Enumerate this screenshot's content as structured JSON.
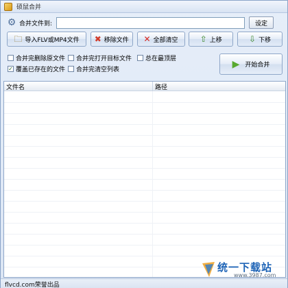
{
  "window": {
    "title": "硕鼠合并"
  },
  "merge_target": {
    "label": "合并文件到:",
    "value": "",
    "placeholder": ""
  },
  "buttons": {
    "set": "设定",
    "import": "导入FLV或MP4文件",
    "remove": "移除文件",
    "clear_all": "全部清空",
    "move_up": "上移",
    "move_down": "下移",
    "start_merge": "开始合并"
  },
  "options": [
    {
      "label": "合并完删除原文件",
      "checked": false
    },
    {
      "label": "合并完打开目标文件",
      "checked": false
    },
    {
      "label": "总在最顶层",
      "checked": false
    },
    {
      "label": "覆盖已存在的文件",
      "checked": true
    },
    {
      "label": "合并完清空列表",
      "checked": false
    }
  ],
  "file_list": {
    "columns": [
      "文件名",
      "路径"
    ],
    "rows": []
  },
  "status": {
    "text": "flvcd.com荣誉出品"
  },
  "watermark": {
    "brand": "统一下载站",
    "url": "www.3987.com"
  },
  "colors": {
    "window_bg": "#dfe8f6",
    "accent_green": "#58a92f",
    "danger_red": "#d7261e"
  }
}
